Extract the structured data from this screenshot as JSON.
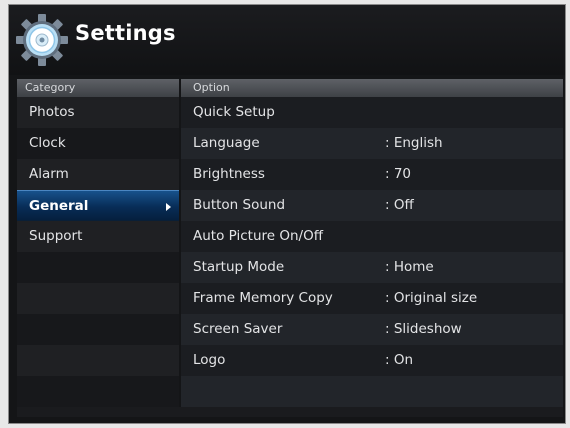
{
  "header": {
    "title": "Settings",
    "icon": "gear-disc-icon"
  },
  "columns": {
    "category": "Category",
    "option": "Option"
  },
  "categories": [
    {
      "label": "Photos",
      "selected": false
    },
    {
      "label": "Clock",
      "selected": false
    },
    {
      "label": "Alarm",
      "selected": false
    },
    {
      "label": "General",
      "selected": true
    },
    {
      "label": "Support",
      "selected": false
    }
  ],
  "options": [
    {
      "name": "Quick Setup",
      "value": ""
    },
    {
      "name": "Language",
      "value": ": English"
    },
    {
      "name": "Brightness",
      "value": ": 70"
    },
    {
      "name": "Button Sound",
      "value": ": Off"
    },
    {
      "name": "Auto Picture On/Off",
      "value": ""
    },
    {
      "name": "Startup Mode",
      "value": ": Home"
    },
    {
      "name": "Frame Memory Copy",
      "value": ": Original size"
    },
    {
      "name": "Screen Saver",
      "value": ": Slideshow"
    },
    {
      "name": "Logo",
      "value": ": On"
    }
  ],
  "colors": {
    "background": "#141517",
    "selection": "#0b3a6b",
    "text": "#e3e4e6"
  }
}
